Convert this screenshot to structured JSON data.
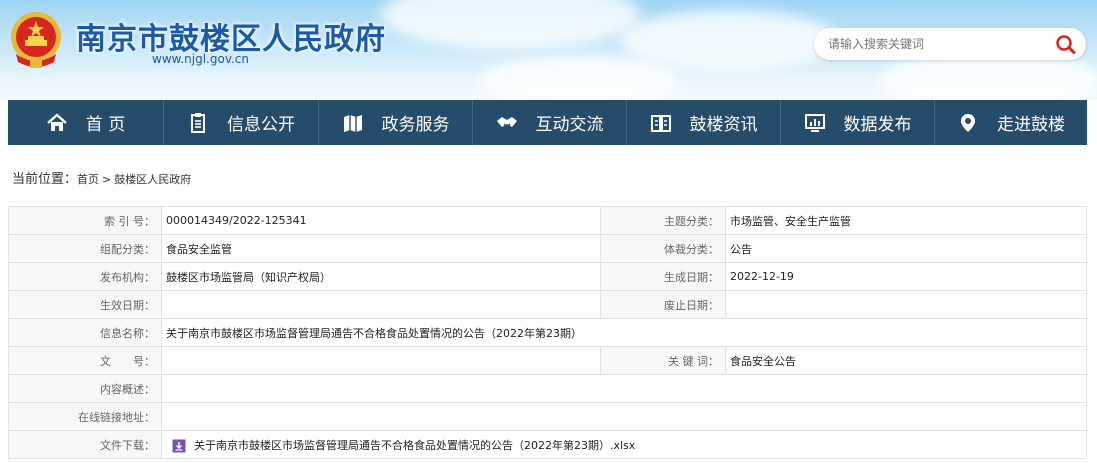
{
  "header": {
    "site_title": "南京市鼓楼区人民政府",
    "site_url": "www.njgl.gov.cn",
    "search_placeholder": "请输入搜索关键词",
    "brand_color": "#1a5aa8"
  },
  "nav": {
    "bg_color": "#254d6b",
    "items": [
      {
        "label": "首 页",
        "icon": "home-icon"
      },
      {
        "label": "信息公开",
        "icon": "document-icon"
      },
      {
        "label": "政务服务",
        "icon": "map-icon"
      },
      {
        "label": "互动交流",
        "icon": "handshake-icon"
      },
      {
        "label": "鼓楼资讯",
        "icon": "book-icon"
      },
      {
        "label": "数据发布",
        "icon": "monitor-icon"
      },
      {
        "label": "走进鼓楼",
        "icon": "location-icon"
      }
    ]
  },
  "breadcrumb": {
    "label": "当前位置：",
    "home": "首页",
    "separator": ">",
    "current": "鼓楼区人民政府"
  },
  "meta": {
    "index_label": "索 引 号：",
    "index_value": "000014349/2022-125341",
    "topic_label": "主题分类：",
    "topic_value": "市场监管、安全生产监管",
    "group_label": "组配分类：",
    "group_value": "食品安全监管",
    "genre_label": "体裁分类：",
    "genre_value": "公告",
    "issuer_label": "发布机构：",
    "issuer_value": "鼓楼区市场监管局（知识产权局）",
    "created_label": "生成日期：",
    "created_value": "2022-12-19",
    "effective_label": "生效日期：",
    "effective_value": "",
    "expire_label": "废止日期：",
    "expire_value": "",
    "name_label": "信息名称：",
    "name_value": "关于南京市鼓楼区市场监督管理局通告不合格食品处置情况的公告（2022年第23期）",
    "docno_label": "文　　号：",
    "docno_value": "",
    "keyword_label": "关 键 词：",
    "keyword_value": "食品安全公告",
    "summary_label": "内容概述：",
    "summary_value": "",
    "link_label": "在线链接地址：",
    "link_value": "",
    "download_label": "文件下载：",
    "download_value": "关于南京市鼓楼区市场监督管理局通告不合格食品处置情况的公告（2022年第23期）.xlsx"
  }
}
